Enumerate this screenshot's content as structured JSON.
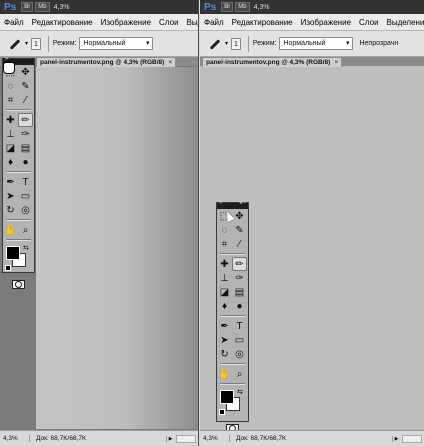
{
  "app": {
    "logo": "Ps",
    "mini_buttons": [
      "Br",
      "Mb"
    ],
    "zoom": "4,3%"
  },
  "menu": [
    "Файл",
    "Редактирование",
    "Изображение",
    "Слои",
    "Выделение"
  ],
  "options": {
    "brush_size": "1",
    "mode_label": "Режим:",
    "mode_value": "Нормальный",
    "opacity_label": "Непрозрачн"
  },
  "document": {
    "tab_title": "panel-instrumentov.png @ 4,3% (RGB/8)",
    "close": "×"
  },
  "status": {
    "zoom": "4,3%",
    "doc_size": "Док: 68,7K/68,7K"
  },
  "toolbox": {
    "header_left": "»",
    "header_right": "◂ ×",
    "swap_glyph": "⇆",
    "tools": [
      [
        "marquee-icon",
        "move-icon"
      ],
      [
        "lasso-icon",
        "quick-select-icon"
      ],
      [
        "crop-icon",
        "eyedropper-icon"
      ],
      [
        "healing-brush-icon",
        "brush-icon"
      ],
      [
        "clone-stamp-icon",
        "history-brush-icon"
      ],
      [
        "eraser-icon",
        "gradient-icon"
      ],
      [
        "blur-icon",
        "dodge-icon"
      ],
      [
        "pen-icon",
        "type-icon"
      ],
      [
        "path-select-icon",
        "shape-icon"
      ],
      [
        "3d-rotate-icon",
        "3d-camera-icon"
      ],
      [
        "hand-icon",
        "zoom-icon"
      ]
    ],
    "glyphs": {
      "marquee-icon": "⬚",
      "move-icon": "✥",
      "lasso-icon": "◌",
      "quick-select-icon": "✎",
      "crop-icon": "⌗",
      "eyedropper-icon": "⁄",
      "healing-brush-icon": "✚",
      "brush-icon": "✏",
      "clone-stamp-icon": "⊥",
      "history-brush-icon": "✑",
      "eraser-icon": "◪",
      "gradient-icon": "▤",
      "blur-icon": "♦",
      "dodge-icon": "●",
      "pen-icon": "✒",
      "type-icon": "T",
      "path-select-icon": "➤",
      "shape-icon": "▭",
      "3d-rotate-icon": "↻",
      "3d-camera-icon": "◎",
      "hand-icon": "✋",
      "zoom-icon": "⌕"
    },
    "selected_tool": "brush-icon",
    "foreground_color": "#000000",
    "background_color": "#ffffff"
  }
}
